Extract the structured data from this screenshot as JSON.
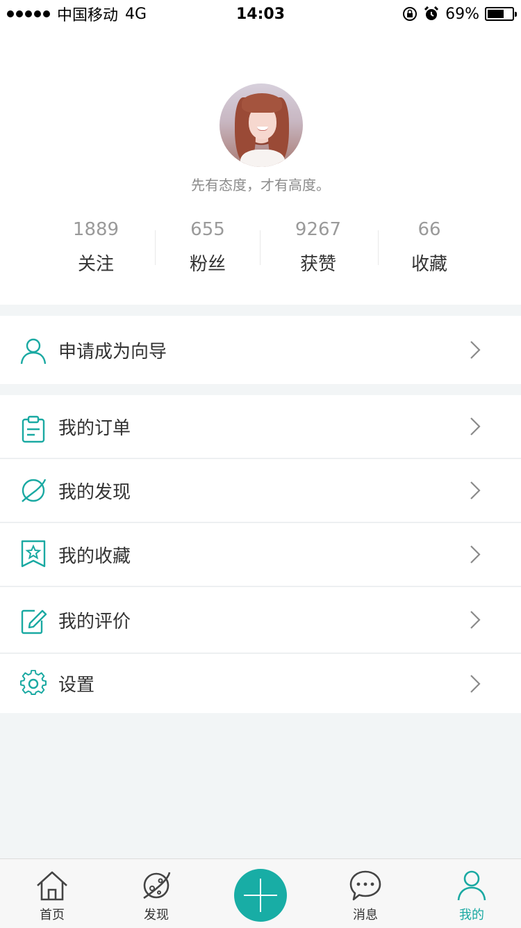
{
  "status_bar": {
    "carrier": "中国移动",
    "network": "4G",
    "time": "14:03",
    "battery": "69%",
    "battery_level": 0.69
  },
  "profile": {
    "motto": "先有态度，才有高度。",
    "stats": [
      {
        "count": "1889",
        "label": "关注"
      },
      {
        "count": "655",
        "label": "粉丝"
      },
      {
        "count": "9267",
        "label": "获赞"
      },
      {
        "count": "66",
        "label": "收藏"
      }
    ]
  },
  "guide_item": {
    "label": "申请成为向导",
    "icon": "person-icon"
  },
  "menu": [
    {
      "label": "我的订单",
      "icon": "clipboard-icon"
    },
    {
      "label": "我的发现",
      "icon": "planet-icon"
    },
    {
      "label": "我的收藏",
      "icon": "bookmark-star-icon"
    },
    {
      "label": "我的评价",
      "icon": "edit-pen-icon"
    },
    {
      "label": "设置",
      "icon": "gear-icon"
    }
  ],
  "tabbar": {
    "tabs": [
      {
        "label": "首页",
        "icon": "home-icon"
      },
      {
        "label": "发现",
        "icon": "planet-icon"
      },
      {
        "label": "消息",
        "icon": "chat-bubble-icon"
      },
      {
        "label": "我的",
        "icon": "person-icon"
      }
    ],
    "active_tab": "我的",
    "accent_color": "#18ada5"
  }
}
